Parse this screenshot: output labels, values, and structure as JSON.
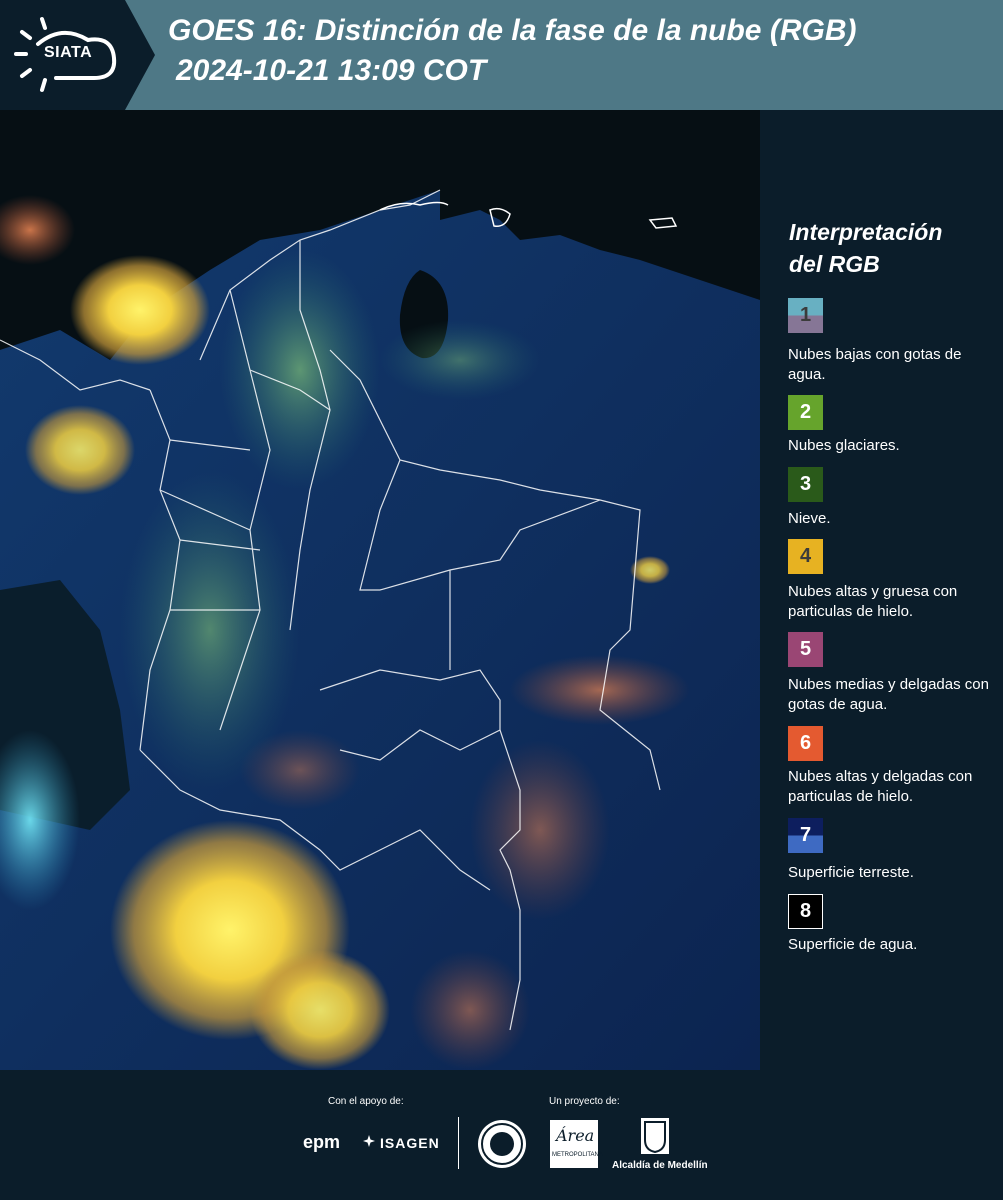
{
  "header": {
    "logo": "SIATA",
    "title": "GOES 16: Distinción de la fase de la nube (RGB)",
    "timestamp": "2024-10-21 13:09 COT"
  },
  "legend": {
    "title_line1": "Interpretación",
    "title_line2": "del RGB",
    "items": [
      {
        "number": "1",
        "label": "Nubes bajas con gotas de agua.",
        "colors": [
          "#68b0c2",
          "#867696"
        ]
      },
      {
        "number": "2",
        "label": "Nubes glaciares.",
        "colors": [
          "#66a42c"
        ]
      },
      {
        "number": "3",
        "label": "Nieve.",
        "colors": [
          "#2a5a1a"
        ]
      },
      {
        "number": "4",
        "label": "Nubes altas y gruesa con particulas de hielo.",
        "colors": [
          "#e7b222"
        ]
      },
      {
        "number": "5",
        "label": "Nubes medias y delgadas con gotas de agua.",
        "colors": [
          "#9a4674"
        ]
      },
      {
        "number": "6",
        "label": "Nubes altas y delgadas con particulas de hielo.",
        "colors": [
          "#e45a30"
        ]
      },
      {
        "number": "7",
        "label": "Superficie terreste.",
        "colors": [
          "#0d1e5e",
          "#3e6ac2"
        ]
      },
      {
        "number": "8",
        "label": "Superficie de agua.",
        "colors": [
          "#000000"
        ]
      }
    ]
  },
  "footer": {
    "support_label": "Con el apoyo de:",
    "project_label": "Un proyecto de:",
    "sponsor_epm": "epm",
    "sponsor_isagen": "ISAGEN",
    "area_label": "Área",
    "area_sub": "METROPOLITANA",
    "medellin": "Alcaldía de Medellín"
  },
  "colors": {
    "background": "#0b1d2a",
    "header": "#4e7886",
    "land": "#0e2a5e",
    "border_lines": "#ffffff"
  }
}
